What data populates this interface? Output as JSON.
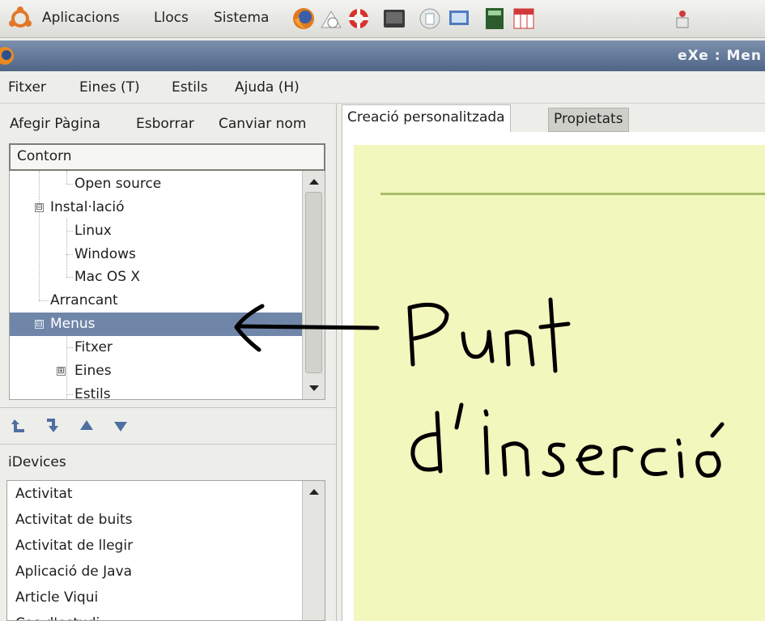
{
  "panel": {
    "applications": "Aplicacions",
    "places": "Llocs",
    "system": "Sistema",
    "launchers": [
      "firefox-icon",
      "clock-icon",
      "lifebuoy-icon",
      "terminal-icon",
      "document-icon",
      "screenshot-icon",
      "calculator-icon",
      "calendar-icon"
    ]
  },
  "window": {
    "title": "eXe : Men"
  },
  "menubar": {
    "file": "Fitxer",
    "tools": "Eines (T)",
    "styles": "Estils",
    "help": "Ajuda (H)"
  },
  "outline_toolbar": {
    "add_page": "Afegir Pàgina",
    "delete": "Esborrar",
    "rename": "Canviar nom"
  },
  "outline": {
    "header": "Contorn",
    "items": [
      {
        "label": "Open source"
      },
      {
        "label": "Instal·lació",
        "expander": "⊟"
      },
      {
        "label": "Linux"
      },
      {
        "label": "Windows"
      },
      {
        "label": "Mac OS X"
      },
      {
        "label": "Arrancant"
      },
      {
        "label": "Menus",
        "expander": "⊟"
      },
      {
        "label": "Fitxer"
      },
      {
        "label": "Eines",
        "expander": "⊞"
      },
      {
        "label": "Estils"
      }
    ]
  },
  "idevices": {
    "label": "iDevices",
    "items": [
      "Activitat",
      "Activitat de buits",
      "Activitat de llegir",
      "Aplicació de Java",
      "Article Viqui",
      "Cas d'estudi"
    ]
  },
  "tabs": {
    "authoring": "Creació personalitzada",
    "properties": "Propietats"
  },
  "annotation": {
    "line1": "Punt",
    "line2": "d'inserció"
  },
  "colors": {
    "selection": "#6f86a9",
    "editor_bg": "#f1f7bd",
    "titlebar": "#5b7090"
  }
}
